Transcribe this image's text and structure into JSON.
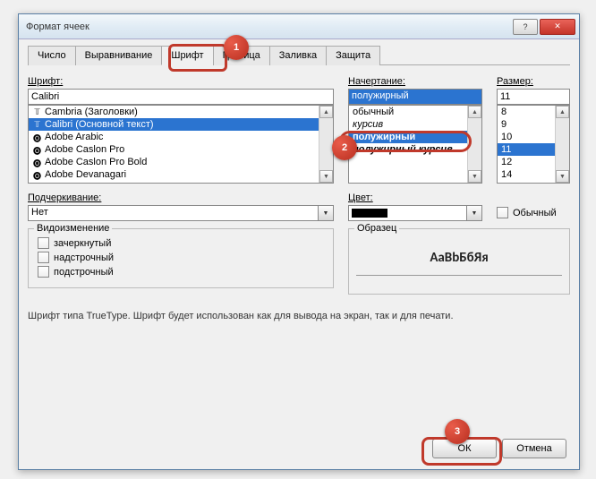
{
  "window": {
    "title": "Формат ячеек"
  },
  "tabs": {
    "items": [
      {
        "label": "Число"
      },
      {
        "label": "Выравнивание"
      },
      {
        "label": "Шрифт"
      },
      {
        "label": "Граница"
      },
      {
        "label": "Заливка"
      },
      {
        "label": "Защита"
      }
    ],
    "activeIndex": 2
  },
  "font": {
    "label": "Шрифт:",
    "value": "Calibri",
    "items": [
      "Cambria (Заголовки)",
      "Calibri (Основной текст)",
      "Adobe Arabic",
      "Adobe Caslon Pro",
      "Adobe Caslon Pro Bold",
      "Adobe Devanagari"
    ],
    "selectedIndex": 1
  },
  "style": {
    "label": "Начертание:",
    "value": "полужирный",
    "items": [
      "обычный",
      "курсив",
      "полужирный",
      "полужирный курсив"
    ],
    "selectedIndex": 2
  },
  "size": {
    "label": "Размер:",
    "value": "11",
    "items": [
      "8",
      "9",
      "10",
      "11",
      "12",
      "14"
    ],
    "selectedIndex": 3
  },
  "underline": {
    "label": "Подчеркивание:",
    "value": "Нет"
  },
  "color": {
    "label": "Цвет:"
  },
  "normal": {
    "label": "Обычный"
  },
  "effects": {
    "label": "Видоизменение",
    "items": [
      {
        "label": "зачеркнутый"
      },
      {
        "label": "надстрочный"
      },
      {
        "label": "подстрочный"
      }
    ]
  },
  "sample": {
    "label": "Образец",
    "text": "AaBbБбЯя"
  },
  "description": "Шрифт типа TrueType. Шрифт будет использован как для вывода на экран, так и для печати.",
  "buttons": {
    "ok": "ОК",
    "cancel": "Отмена"
  },
  "callouts": {
    "n1": "1",
    "n2": "2",
    "n3": "3"
  }
}
